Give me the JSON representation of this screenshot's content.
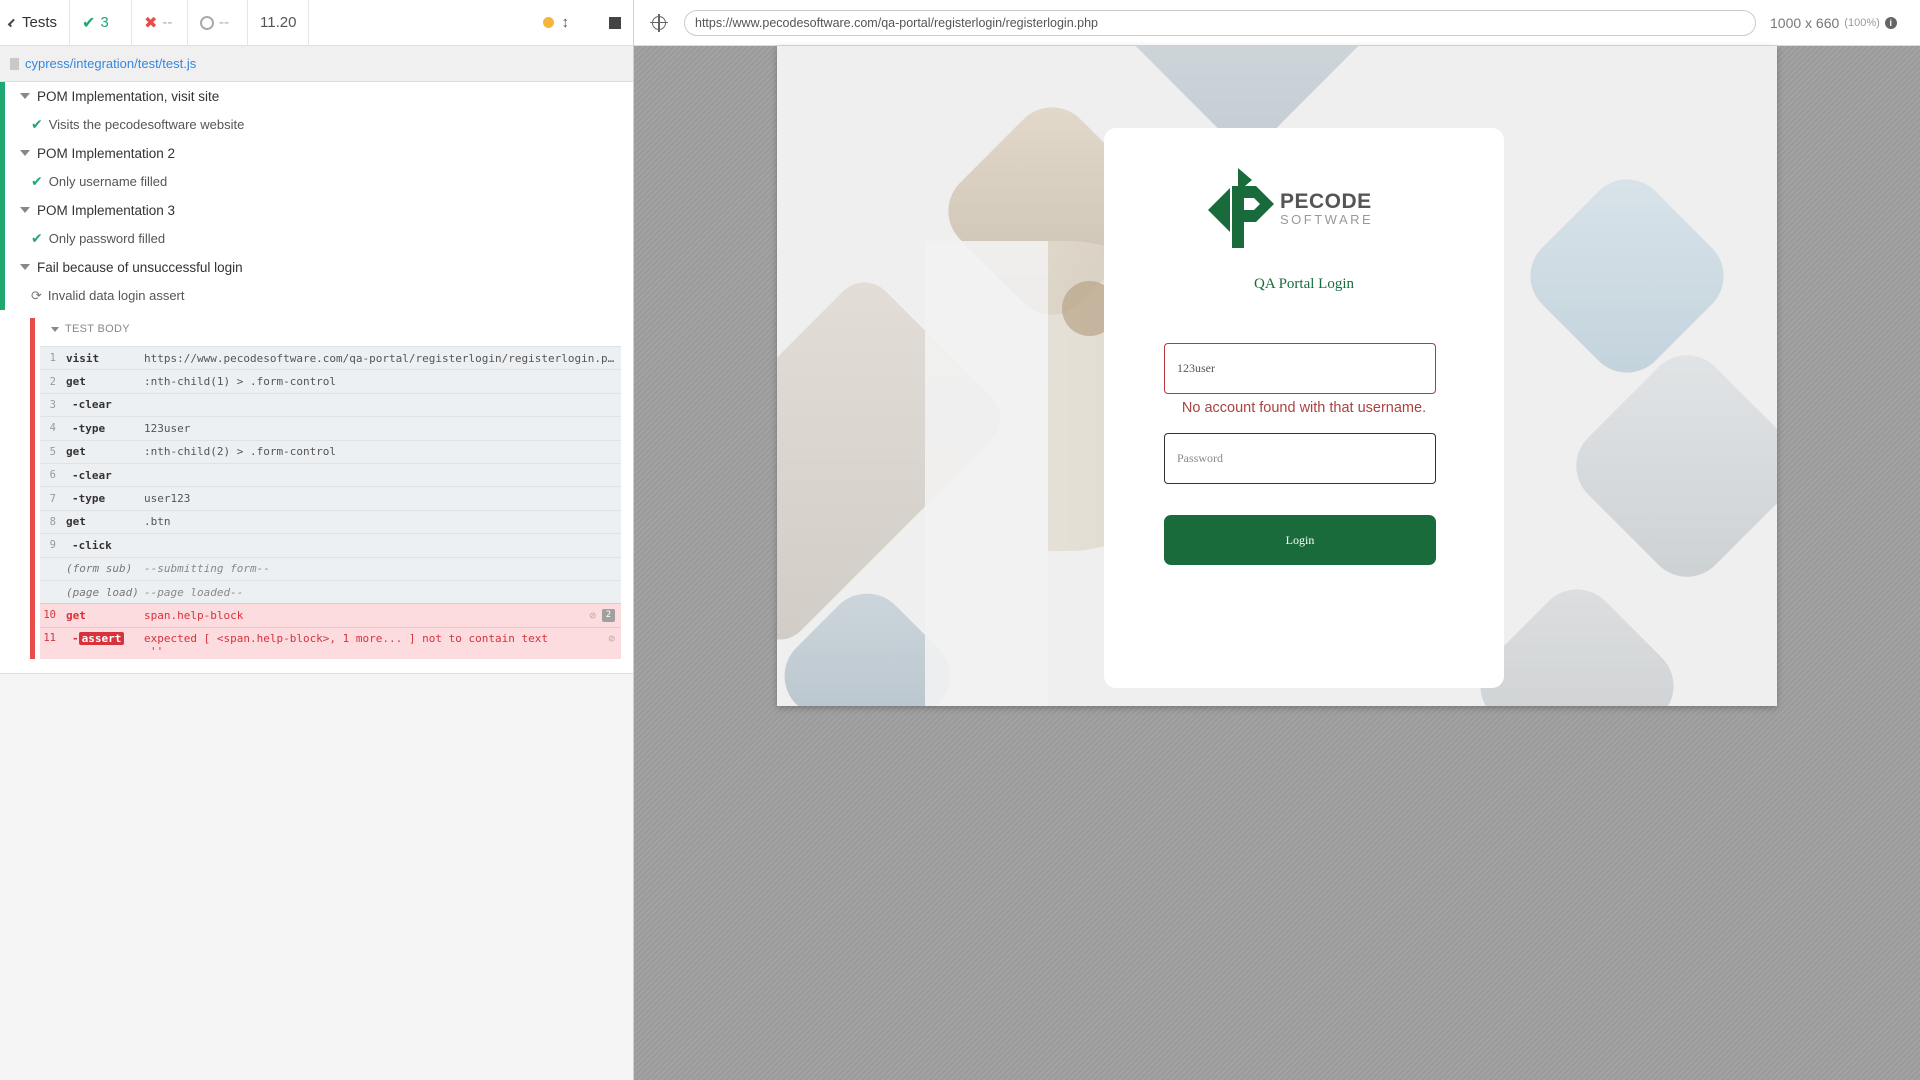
{
  "reporter": {
    "header": {
      "tests_label": "Tests",
      "passed": "3",
      "failed": "--",
      "pending": "--",
      "duration": "11.20"
    },
    "spec_path": "cypress/integration/test/test.js",
    "suites": [
      {
        "title": "POM Implementation, visit site",
        "test": "Visits the pecodesoftware website"
      },
      {
        "title": "POM Implementation 2",
        "test": "Only username filled"
      },
      {
        "title": "POM Implementation 3",
        "test": "Only password filled"
      },
      {
        "title": "Fail because of unsuccessful login",
        "test": "Invalid data login assert"
      }
    ],
    "test_body_label": "TEST BODY",
    "commands": [
      {
        "num": "1",
        "name": "visit",
        "msg": "https://www.pecodesoftware.com/qa-portal/registerlogin/registerlogin.php"
      },
      {
        "num": "2",
        "name": "get",
        "msg": ":nth-child(1) > .form-control"
      },
      {
        "num": "3",
        "name": "-clear",
        "msg": ""
      },
      {
        "num": "4",
        "name": "-type",
        "msg": "123user"
      },
      {
        "num": "5",
        "name": "get",
        "msg": ":nth-child(2) > .form-control"
      },
      {
        "num": "6",
        "name": "-clear",
        "msg": ""
      },
      {
        "num": "7",
        "name": "-type",
        "msg": "user123"
      },
      {
        "num": "8",
        "name": "get",
        "msg": ".btn"
      },
      {
        "num": "9",
        "name": "-click",
        "msg": ""
      },
      {
        "num": "",
        "name": "(form sub)",
        "msg": "--submitting form--"
      },
      {
        "num": "",
        "name": "(page load)",
        "msg": "--page loaded--"
      },
      {
        "num": "10",
        "name": "get",
        "msg": "span.help-block",
        "badge": "2"
      },
      {
        "num": "11",
        "name": "-",
        "tag": "assert",
        "msg": "expected [ <span.help-block>, 1 more... ] not to contain text",
        "msg2": "''"
      }
    ]
  },
  "aut": {
    "url": "https://www.pecodesoftware.com/qa-portal/registerlogin/registerlogin.php",
    "viewport": "1000 x 660",
    "viewport_pct": "(100%)"
  },
  "app": {
    "logo_word": "PECODE",
    "logo_sub": "SOFTWARE",
    "title": "QA Portal Login",
    "username_value": "123user",
    "error_text": "No account found with that username.",
    "password_placeholder": "Password",
    "login_button": "Login",
    "brand_color": "#1a6b3c",
    "error_color": "#a94442"
  }
}
